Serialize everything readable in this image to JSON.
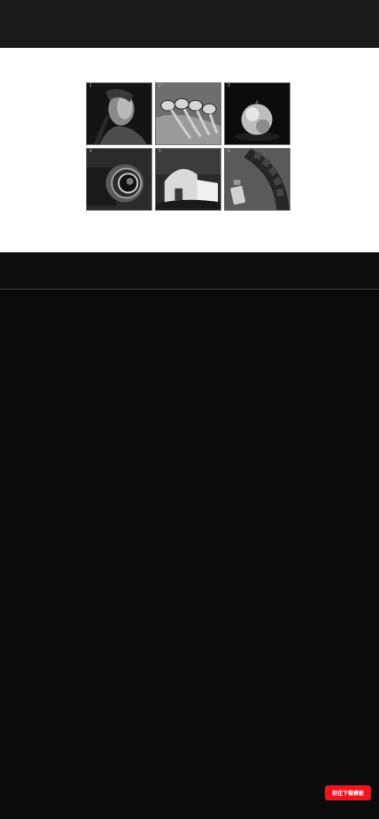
{
  "gallery": {
    "tiles": [
      {
        "num": "1",
        "subject": "portrait"
      },
      {
        "num": "2",
        "subject": "spoons"
      },
      {
        "num": "3",
        "subject": "fruit"
      },
      {
        "num": "4",
        "subject": "camera-lens"
      },
      {
        "num": "5",
        "subject": "building"
      },
      {
        "num": "6",
        "subject": "gear"
      }
    ]
  },
  "cta": {
    "label": "前往下载模板"
  },
  "colors": {
    "top_bar": "#1b1b1b",
    "band": "#ffffff",
    "background": "#0b0b0b",
    "cta": "#f0141e"
  }
}
